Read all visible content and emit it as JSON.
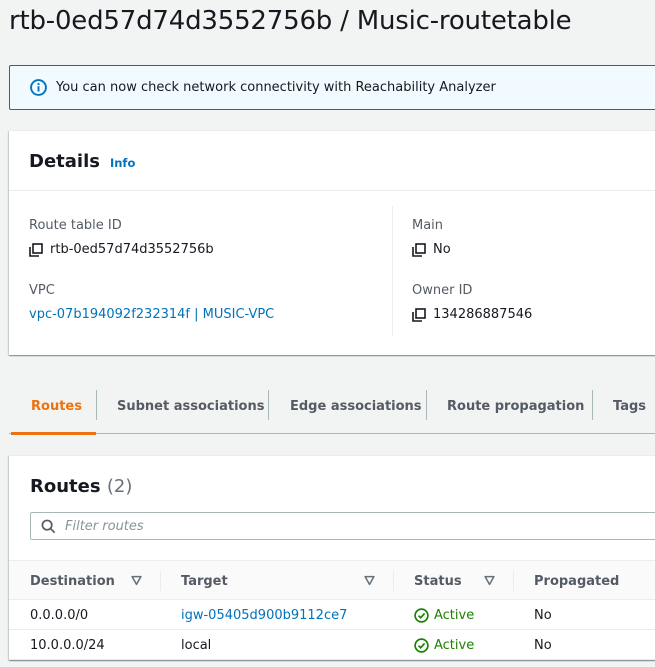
{
  "page": {
    "title": "rtb-0ed57d74d3552756b / Music-routetable"
  },
  "flash": {
    "message": "You can now check network connectivity with Reachability Analyzer",
    "icon": "info-icon"
  },
  "details": {
    "title": "Details",
    "info_label": "Info",
    "fields": {
      "route_table_id": {
        "label": "Route table ID",
        "value": "rtb-0ed57d74d3552756b"
      },
      "main": {
        "label": "Main",
        "value": "No"
      },
      "vpc": {
        "label": "VPC",
        "value": "vpc-07b194092f232314f | MUSIC-VPC"
      },
      "owner_id": {
        "label": "Owner ID",
        "value": "134286887546"
      }
    }
  },
  "tabs": [
    {
      "label": "Routes",
      "active": true
    },
    {
      "label": "Subnet associations",
      "active": false
    },
    {
      "label": "Edge associations",
      "active": false
    },
    {
      "label": "Route propagation",
      "active": false
    },
    {
      "label": "Tags",
      "active": false
    }
  ],
  "routes": {
    "title": "Routes",
    "count": "(2)",
    "filter_placeholder": "Filter routes",
    "columns": [
      "Destination",
      "Target",
      "Status",
      "Propagated"
    ],
    "rows": [
      {
        "destination": "0.0.0.0/0",
        "target": "igw-05405d900b9112ce7",
        "target_is_link": true,
        "status": "Active",
        "propagated": "No"
      },
      {
        "destination": "10.0.0.0/24",
        "target": "local",
        "target_is_link": false,
        "status": "Active",
        "propagated": "No"
      }
    ]
  },
  "colors": {
    "accent": "#ec7211",
    "link": "#0073bb",
    "success": "#1d8102",
    "info_border": "#0073bb",
    "info_bg": "#f1faff"
  }
}
